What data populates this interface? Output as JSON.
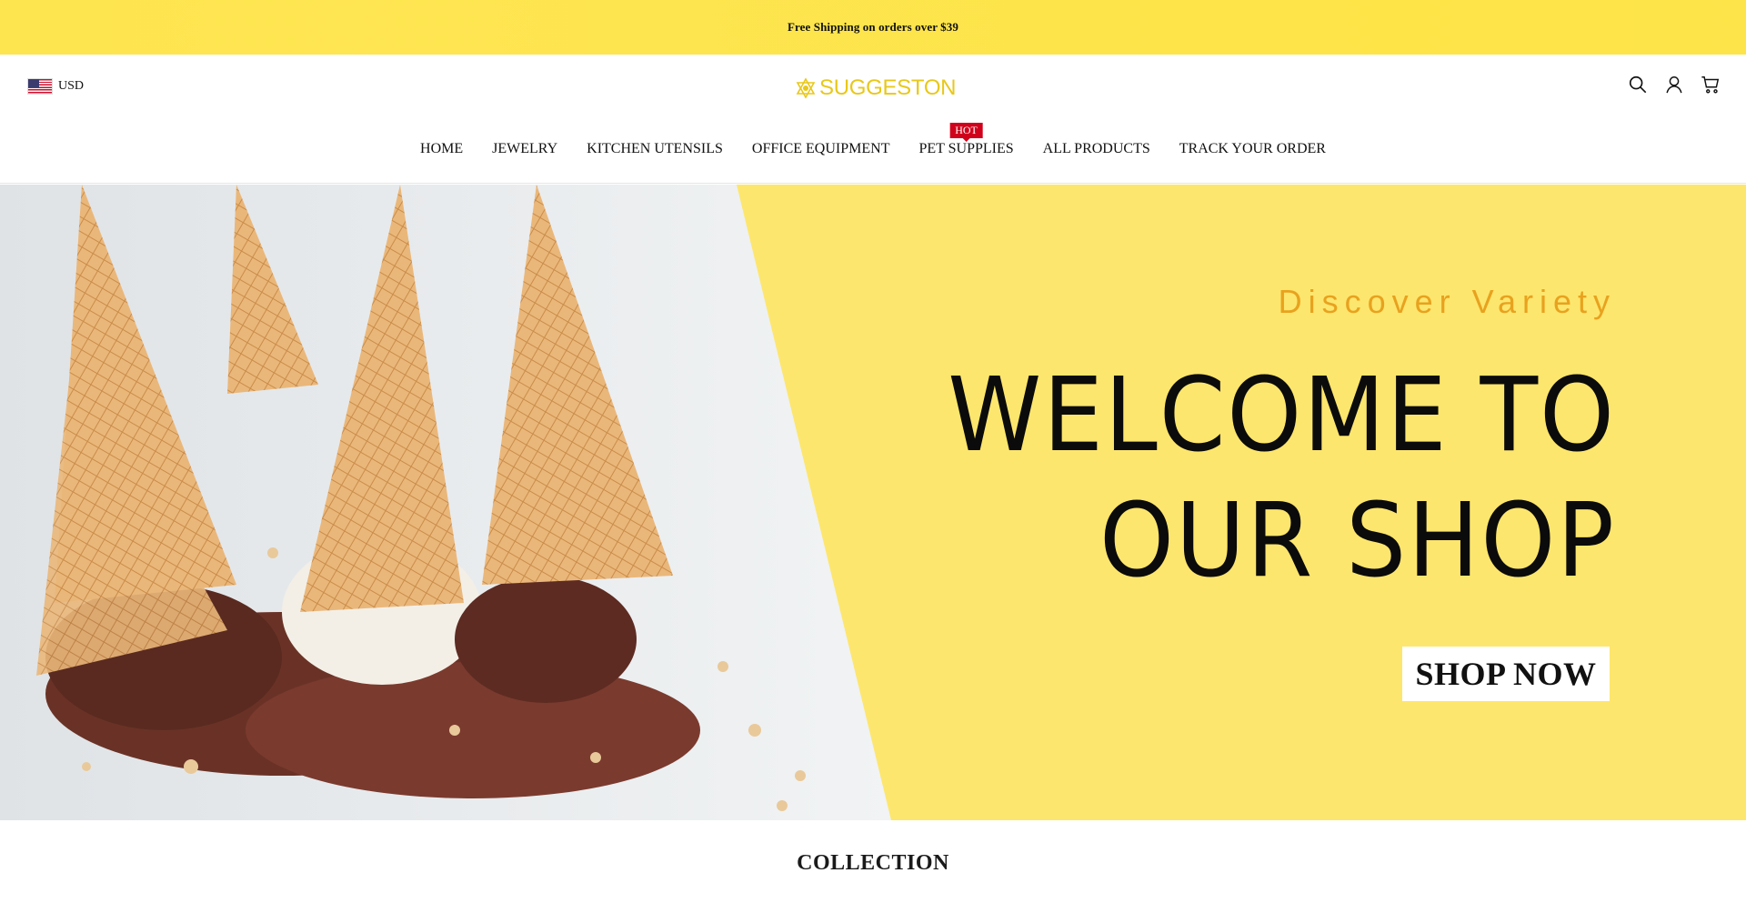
{
  "announcement": {
    "text": "Free Shipping on orders over $39"
  },
  "header": {
    "currency": {
      "code": "USD",
      "flag_icon": "us-flag-icon"
    },
    "logo": {
      "text": "SUGGESTON",
      "color": "#e8c81a"
    },
    "icons": [
      "search-icon",
      "account-icon",
      "cart-icon"
    ]
  },
  "nav": {
    "items": [
      {
        "label": "HOME"
      },
      {
        "label": "JEWELRY"
      },
      {
        "label": "KITCHEN UTENSILS"
      },
      {
        "label": "OFFICE EQUIPMENT"
      },
      {
        "label": "PET SUPPLIES",
        "badge": "HOT"
      },
      {
        "label": "ALL PRODUCTS"
      },
      {
        "label": "TRACK YOUR ORDER"
      }
    ]
  },
  "hero": {
    "subtitle": "Discover Variety",
    "title_line1": "WELCOME TO",
    "title_line2": "OUR SHOP",
    "cta": "SHOP NOW",
    "background": "#fde66d",
    "subtitle_color": "#e8a21f"
  },
  "collection": {
    "title": "COLLECTION"
  },
  "colors": {
    "announcement_bg": "#fde54d",
    "badge_red": "#d0021b"
  }
}
